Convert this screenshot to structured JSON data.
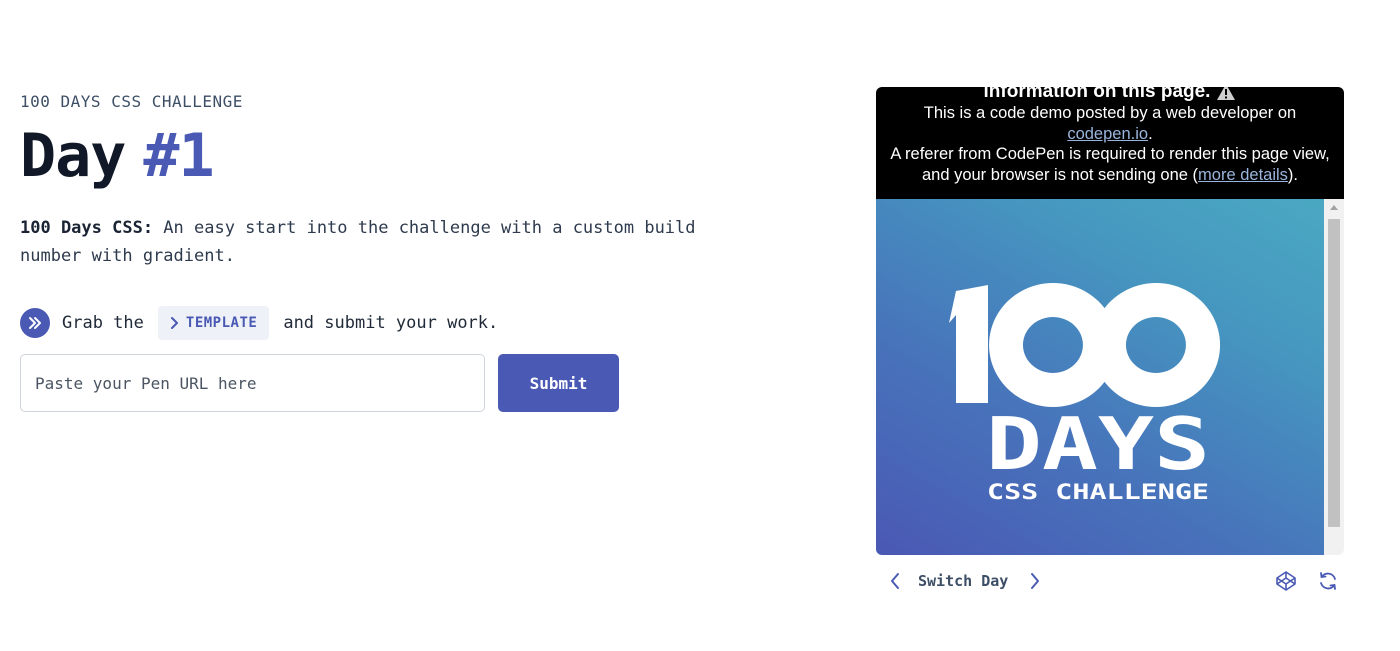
{
  "header": {
    "eyebrow": "100 DAYS CSS CHALLENGE",
    "title_word": "Day",
    "title_number": "#1"
  },
  "description": {
    "lead": "100 Days CSS:",
    "body": " An easy start into the challenge with a custom build number with gradient."
  },
  "grab": {
    "prefix": "Grab the",
    "template_label": "TEMPLATE",
    "suffix": "and submit your work."
  },
  "submission": {
    "placeholder": "Paste your Pen URL here",
    "submit_label": "Submit"
  },
  "preview": {
    "notice": {
      "heading": "information on this page.",
      "line1": "This is a code demo posted by a web developer on",
      "link_codepen": "codepen.io",
      "line1_end": ".",
      "line2": "A referer from CodePen is required to render this page view, and your browser is not sending one (",
      "link_details": "more details",
      "line2_end": ")."
    },
    "artwork": {
      "number": "100",
      "word": "DAYS",
      "subtitle": "CSS CHALLENGE"
    }
  },
  "controls": {
    "switch_label": "Switch Day"
  },
  "colors": {
    "accent": "#4a5ab4",
    "text_muted": "#3d4f66",
    "notice_bg": "#000000",
    "gradient_start": "#4a58b4",
    "gradient_end": "#4aa8c2"
  },
  "icons": {
    "grab": "chevrons-right-icon",
    "template": "chevron-right-icon",
    "warning": "warning-icon",
    "prev": "chevron-left-icon",
    "next": "chevron-right-icon",
    "codepen": "codepen-icon",
    "refresh": "refresh-icon"
  }
}
